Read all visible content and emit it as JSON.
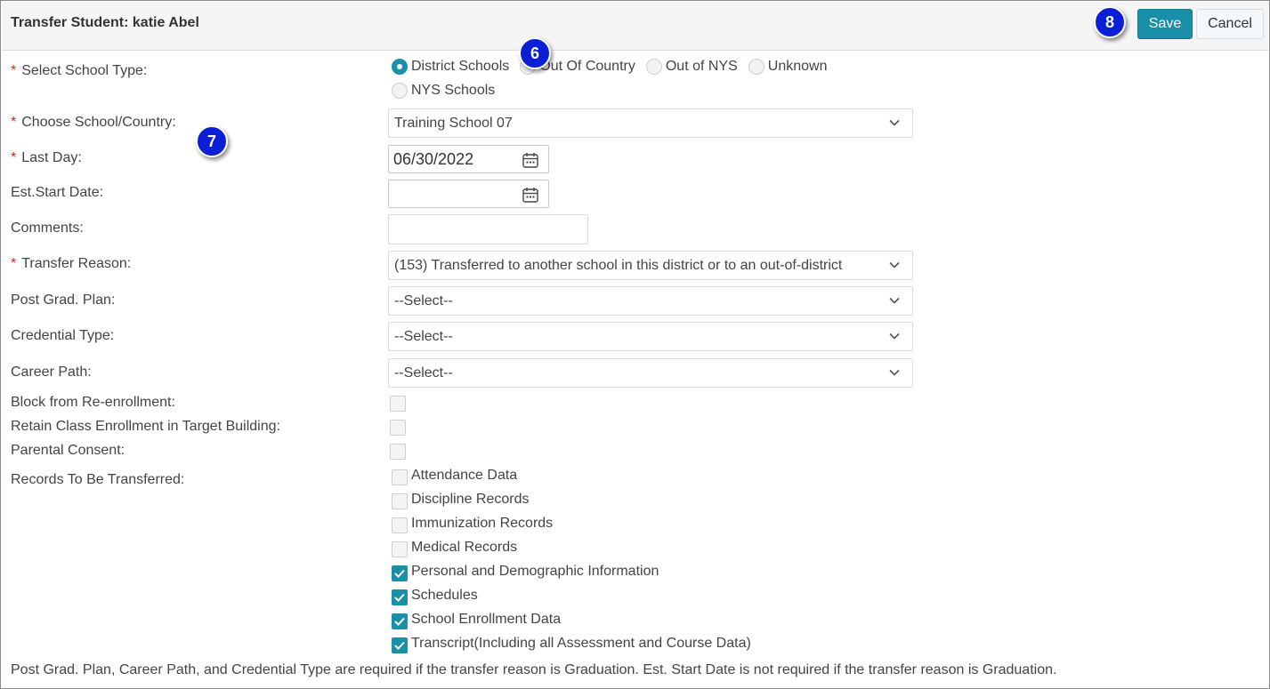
{
  "header": {
    "title": "Transfer Student: katie Abel",
    "save_label": "Save",
    "cancel_label": "Cancel"
  },
  "callouts": {
    "six": "6",
    "seven": "7",
    "eight": "8"
  },
  "form": {
    "school_type": {
      "label": "Select School Type:",
      "options": [
        "District Schools",
        "Out Of Country",
        "Out of NYS",
        "Unknown",
        "NYS Schools"
      ],
      "selected": "District Schools"
    },
    "choose_school": {
      "label": "Choose School/Country:",
      "value": "Training School 07"
    },
    "last_day": {
      "label": "Last Day:",
      "value": "06/30/2022"
    },
    "est_start_date": {
      "label": "Est.Start Date:",
      "value": ""
    },
    "comments": {
      "label": "Comments:",
      "value": ""
    },
    "transfer_reason": {
      "label": "Transfer Reason:",
      "value": "(153) Transferred to another school in this district or to an out-of-district"
    },
    "post_grad_plan": {
      "label": "Post Grad. Plan:",
      "value": "--Select--"
    },
    "credential_type": {
      "label": "Credential Type:",
      "value": "--Select--"
    },
    "career_path": {
      "label": "Career Path:",
      "value": "--Select--"
    },
    "block_reenrollment": {
      "label": "Block from Re-enrollment:",
      "checked": false
    },
    "retain_class": {
      "label": "Retain Class Enrollment in Target Building:",
      "checked": false
    },
    "parental_consent": {
      "label": "Parental Consent:",
      "checked": false
    },
    "records": {
      "label": "Records To Be Transferred:",
      "items": [
        {
          "label": "Attendance Data",
          "checked": false
        },
        {
          "label": "Discipline Records",
          "checked": false
        },
        {
          "label": "Immunization Records",
          "checked": false
        },
        {
          "label": "Medical Records",
          "checked": false
        },
        {
          "label": "Personal and Demographic Information",
          "checked": true
        },
        {
          "label": "Schedules",
          "checked": true
        },
        {
          "label": "School Enrollment Data",
          "checked": true
        },
        {
          "label": "Transcript(Including all Assessment and Course Data)",
          "checked": true
        }
      ]
    }
  },
  "footnote": "Post Grad. Plan, Career Path, and Credential Type are required if the transfer reason is Graduation. Est. Start Date is not required if the transfer reason is Graduation.",
  "colors": {
    "accent": "#1a8fa8",
    "required": "#d9261c",
    "callout": "#0b1fd6"
  }
}
